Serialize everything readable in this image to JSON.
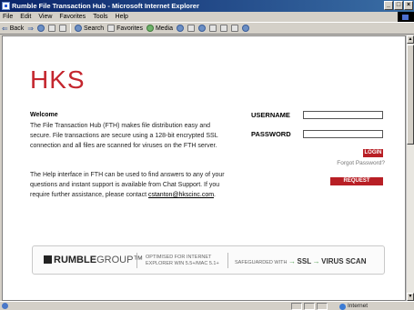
{
  "window": {
    "title": "Rumble File Transaction Hub - Microsoft Internet Explorer",
    "controls": [
      "_",
      "□",
      "×"
    ]
  },
  "menu": [
    "File",
    "Edit",
    "View",
    "Favorites",
    "Tools",
    "Help"
  ],
  "toolbar": {
    "back": "Back",
    "search": "Search",
    "favorites": "Favorites",
    "media": "Media"
  },
  "page": {
    "logo": "HKS",
    "welcome_title": "Welcome",
    "para1": "The File Transaction Hub (FTH) makes file distribution easy and secure. File transactions are secure using a 128-bit encrypted SSL connection and all files are scanned for viruses on the FTH server.",
    "para2_prefix": "The Help interface in FTH can be used to find answers to any of your questions and instant support is available from Chat Support. If you require further assistance, please contact ",
    "para2_email": "cstanton@hkscinc.com",
    "para2_suffix": ".",
    "username_label": "USERNAME",
    "password_label": "PASSWORD",
    "username_value": "",
    "password_value": "",
    "login_button": "LOGIN",
    "forgot_link": "Forgot Password?",
    "request_button": "REQUEST ACCOUNT"
  },
  "footer": {
    "brand_bold": "RUMBLE",
    "brand_light": "GROUP",
    "brand_tm": "™",
    "optimised_line1": "OPTIMISED FOR INTERNET",
    "optimised_line2": "EXPLORER WIN 5.5+/MAC 5.1+",
    "safeguarded": "SAFEGUARDED WITH",
    "ssl": "SSL",
    "virus": "VIRUS SCAN",
    "arrow": "→"
  },
  "status": {
    "zone": "Internet"
  },
  "colors": {
    "brand_red": "#c4262e",
    "button_red": "#b81f25",
    "title_blue": "#0a246a"
  }
}
